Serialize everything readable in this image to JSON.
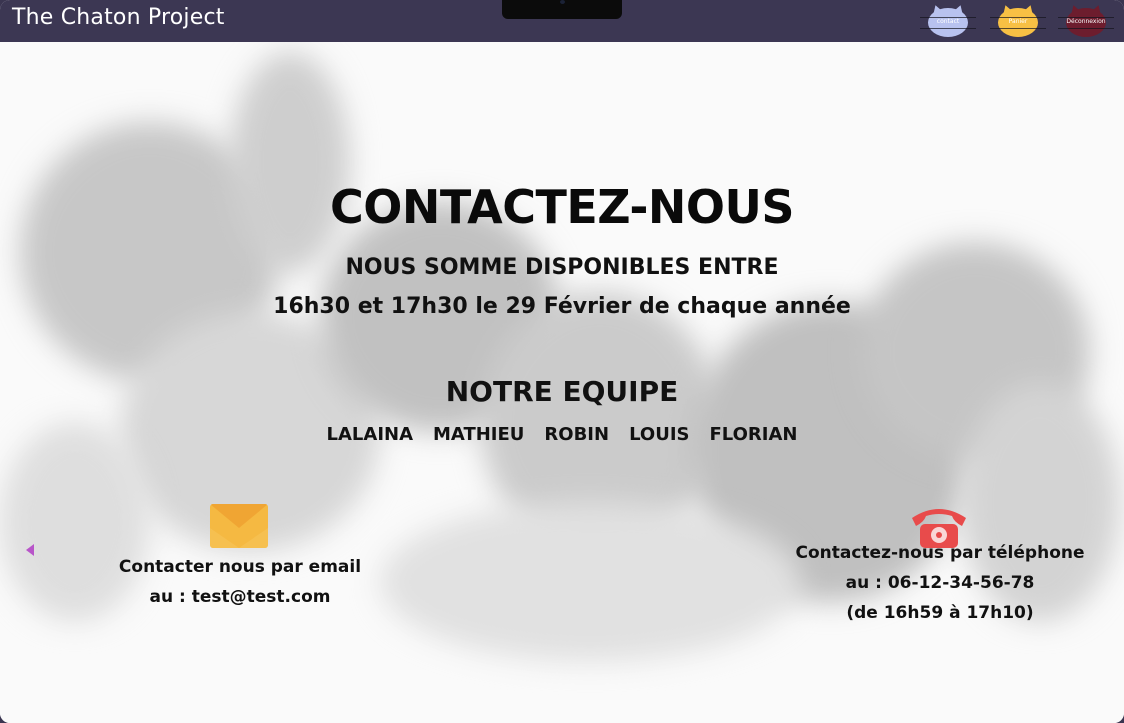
{
  "header": {
    "brand": "The Chaton Project",
    "nav": [
      {
        "label": "contact",
        "color": "#b8c2ef"
      },
      {
        "label": "Panier",
        "color": "#f8c044"
      },
      {
        "label": "Déconnexion",
        "color": "#6d1d2e"
      }
    ]
  },
  "main": {
    "title": "CONTACTEZ-NOUS",
    "availability_line1": "NOUS SOMME DISPONIBLES ENTRE",
    "availability_line2": "16h30 et 17h30 le 29 Février de chaque année",
    "team_title": "NOTRE EQUIPE",
    "team": [
      "LALAINA",
      "MATHIEU",
      "ROBIN",
      "LOUIS",
      "FLORIAN"
    ]
  },
  "email": {
    "icon": "envelope-icon",
    "line1": "Contacter nous par email",
    "line2": "au : test@test.com"
  },
  "phone": {
    "icon": "telephone-icon",
    "line1": "Contactez-nous par téléphone",
    "line2": "au : 06-12-34-56-78",
    "line3": "(de 16h59 à 17h10)"
  },
  "colors": {
    "topbar": "#3c3753",
    "accent_arrow": "#b855c9",
    "envelope": "#f5b942",
    "phone": "#e84b4b"
  }
}
